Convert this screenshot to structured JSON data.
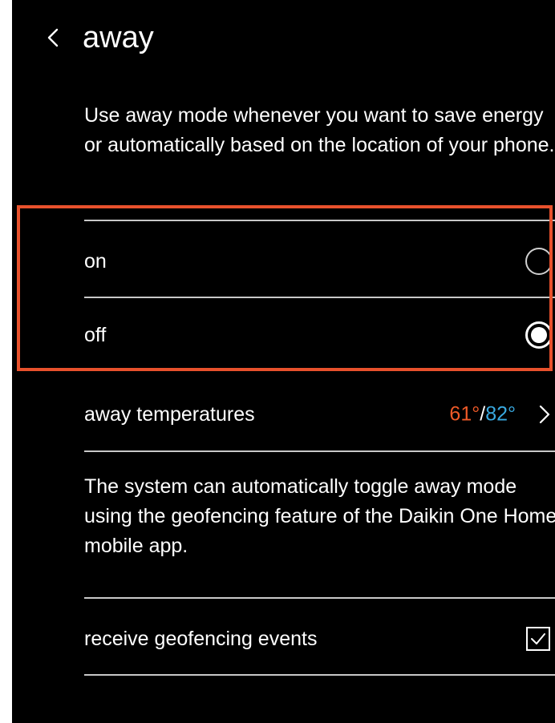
{
  "header": {
    "title": "away",
    "back_icon": "chevron-left-icon"
  },
  "intro_text": "Use away mode whenever you want to save energy or automatically based on the location of your phone.",
  "mode_options": [
    {
      "label": "on",
      "selected": false
    },
    {
      "label": "off",
      "selected": true
    }
  ],
  "away_temperatures": {
    "label": "away temperatures",
    "heat": "61°",
    "separator": "/",
    "cool": "82°",
    "icon": "chevron-right-icon"
  },
  "geofencing_text": "The system can automatically toggle away mode using the geofencing feature of the Daikin One Home mobile app.",
  "geofencing": {
    "label": "receive geofencing events",
    "checked": true,
    "icon": "checkbox-checked-icon"
  },
  "colors": {
    "background": "#000000",
    "highlight": "#e8512c",
    "heat": "#f05a28",
    "cool": "#39a9e0"
  }
}
